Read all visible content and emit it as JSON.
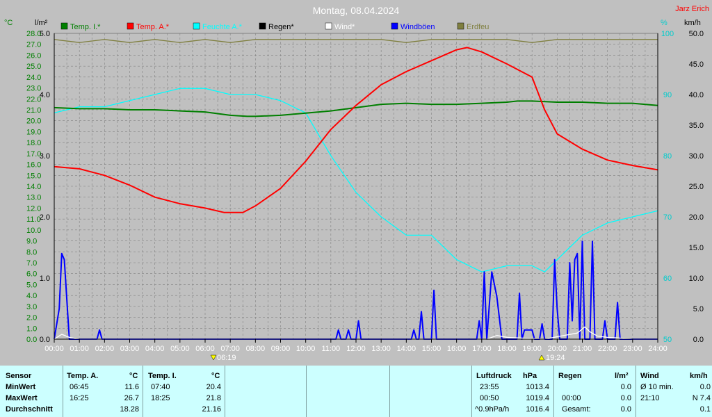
{
  "title": "Montag, 08.04.2024",
  "author": "Jarz Erich",
  "unit_labels": {
    "celsius": "°C",
    "rain": "l/m²",
    "percent": "%",
    "kmh": "km/h"
  },
  "legend": [
    {
      "label": "Temp. I.*",
      "color": "#007f00"
    },
    {
      "label": "Temp. A.*",
      "color": "#ff0000"
    },
    {
      "label": "Feuchte A.*",
      "color": "#00ffff"
    },
    {
      "label": "Regen*",
      "color": "#000000"
    },
    {
      "label": "Wind*",
      "color": "#ffffff"
    },
    {
      "label": "Windböen",
      "color": "#0000ff"
    },
    {
      "label": "Erdfeu",
      "color": "#7f7f3f"
    }
  ],
  "sun": {
    "rise": "06:19",
    "set": "19:24"
  },
  "colors": {
    "temp_axis": "#007f00",
    "humidity_axis": "#00cccc",
    "grid": "#808080",
    "panel_bg": "#ccffff"
  },
  "chart_data": {
    "type": "line",
    "title": "Montag, 08.04.2024",
    "x_ticks": [
      "00:00",
      "01:00",
      "02:00",
      "03:00",
      "04:00",
      "05:00",
      "06:00",
      "07:00",
      "08:00",
      "09:00",
      "10:00",
      "11:00",
      "12:00",
      "13:00",
      "14:00",
      "15:00",
      "16:00",
      "17:00",
      "18:00",
      "19:00",
      "20:00",
      "21:00",
      "22:00",
      "23:00",
      "24:00"
    ],
    "axes": {
      "temp_c": {
        "ylim": [
          0,
          28
        ],
        "ticks": [
          "0.0",
          "1.0",
          "2.0",
          "3.0",
          "4.0",
          "5.0",
          "6.0",
          "7.0",
          "8.0",
          "9.0",
          "10.0",
          "11.0",
          "12.0",
          "13.0",
          "14.0",
          "15.0",
          "16.0",
          "17.0",
          "18.0",
          "19.0",
          "20.0",
          "21.0",
          "22.0",
          "23.0",
          "24.0",
          "25.0",
          "26.0",
          "27.0",
          "28.0"
        ]
      },
      "rain": {
        "ylim": [
          0,
          5
        ],
        "ticks": [
          "0.0",
          "1.0",
          "2.0",
          "3.0",
          "4.0",
          "5.0"
        ]
      },
      "humidity": {
        "ylim": [
          50,
          100
        ],
        "ticks": [
          "50",
          "60",
          "70",
          "80",
          "90",
          "100"
        ]
      },
      "wind": {
        "ylim": [
          0,
          50
        ],
        "ticks": [
          "0.0",
          "5.0",
          "10.0",
          "15.0",
          "20.0",
          "25.0",
          "30.0",
          "35.0",
          "40.0",
          "45.0",
          "50.0"
        ]
      }
    },
    "series": [
      {
        "name": "Temp. I.*",
        "axis": "temp_c",
        "color": "#007f00",
        "points": [
          [
            0,
            21.2
          ],
          [
            1,
            21.1
          ],
          [
            2,
            21.1
          ],
          [
            3,
            21.0
          ],
          [
            4,
            21.0
          ],
          [
            5,
            20.9
          ],
          [
            6,
            20.8
          ],
          [
            7,
            20.5
          ],
          [
            7.67,
            20.4
          ],
          [
            8,
            20.4
          ],
          [
            9,
            20.5
          ],
          [
            10,
            20.7
          ],
          [
            11,
            20.9
          ],
          [
            12,
            21.2
          ],
          [
            13,
            21.5
          ],
          [
            14,
            21.6
          ],
          [
            15,
            21.5
          ],
          [
            16,
            21.5
          ],
          [
            17,
            21.6
          ],
          [
            18,
            21.7
          ],
          [
            18.42,
            21.8
          ],
          [
            19,
            21.8
          ],
          [
            20,
            21.7
          ],
          [
            21,
            21.7
          ],
          [
            22,
            21.6
          ],
          [
            23,
            21.6
          ],
          [
            24,
            21.4
          ]
        ]
      },
      {
        "name": "Temp. A.*",
        "axis": "temp_c",
        "color": "#ff0000",
        "points": [
          [
            0,
            15.8
          ],
          [
            1,
            15.6
          ],
          [
            2,
            15.0
          ],
          [
            3,
            14.1
          ],
          [
            4,
            13.0
          ],
          [
            5,
            12.4
          ],
          [
            6,
            12.0
          ],
          [
            6.75,
            11.6
          ],
          [
            7.5,
            11.6
          ],
          [
            8,
            12.2
          ],
          [
            9,
            13.8
          ],
          [
            10,
            16.3
          ],
          [
            11,
            19.2
          ],
          [
            12,
            21.4
          ],
          [
            13,
            23.3
          ],
          [
            14,
            24.5
          ],
          [
            15,
            25.5
          ],
          [
            16,
            26.5
          ],
          [
            16.42,
            26.7
          ],
          [
            17,
            26.3
          ],
          [
            18,
            25.2
          ],
          [
            19,
            24.0
          ],
          [
            19.5,
            21.0
          ],
          [
            20,
            18.8
          ],
          [
            21,
            17.4
          ],
          [
            22,
            16.4
          ],
          [
            23,
            15.9
          ],
          [
            24,
            15.5
          ]
        ]
      },
      {
        "name": "Feuchte A.*",
        "axis": "humidity",
        "color": "#00ffff",
        "points": [
          [
            0,
            87
          ],
          [
            1,
            88
          ],
          [
            2,
            88
          ],
          [
            3,
            89
          ],
          [
            4,
            90
          ],
          [
            5,
            91
          ],
          [
            6,
            91
          ],
          [
            7,
            90
          ],
          [
            8,
            90
          ],
          [
            9,
            89
          ],
          [
            10,
            87
          ],
          [
            11,
            80
          ],
          [
            12,
            74
          ],
          [
            13,
            70
          ],
          [
            14,
            67
          ],
          [
            15,
            67
          ],
          [
            16,
            63
          ],
          [
            17,
            61
          ],
          [
            18,
            62
          ],
          [
            19,
            62
          ],
          [
            19.5,
            61
          ],
          [
            20,
            63
          ],
          [
            21,
            67
          ],
          [
            22,
            69
          ],
          [
            23,
            70
          ],
          [
            24,
            71
          ]
        ]
      },
      {
        "name": "Windböen",
        "axis": "wind",
        "color": "#0000ff",
        "points": [
          [
            0,
            0
          ],
          [
            0.2,
            5
          ],
          [
            0.3,
            14
          ],
          [
            0.4,
            13
          ],
          [
            0.6,
            0
          ],
          [
            1.7,
            0
          ],
          [
            1.8,
            1.5
          ],
          [
            1.9,
            0
          ],
          [
            11.2,
            0
          ],
          [
            11.3,
            1.5
          ],
          [
            11.4,
            0
          ],
          [
            11.6,
            0
          ],
          [
            11.7,
            1.5
          ],
          [
            11.8,
            0
          ],
          [
            12.0,
            0
          ],
          [
            12.1,
            3
          ],
          [
            12.2,
            0
          ],
          [
            14.2,
            0
          ],
          [
            14.3,
            1.5
          ],
          [
            14.4,
            0
          ],
          [
            14.5,
            0
          ],
          [
            14.6,
            4.5
          ],
          [
            14.7,
            0
          ],
          [
            15.0,
            0
          ],
          [
            15.1,
            8
          ],
          [
            15.2,
            0
          ],
          [
            16.8,
            0
          ],
          [
            16.9,
            3
          ],
          [
            17.0,
            0
          ],
          [
            17.1,
            11
          ],
          [
            17.2,
            0
          ],
          [
            17.4,
            11
          ],
          [
            17.6,
            7
          ],
          [
            17.8,
            0
          ],
          [
            18.4,
            0
          ],
          [
            18.5,
            7.5
          ],
          [
            18.6,
            0
          ],
          [
            18.7,
            1.5
          ],
          [
            19.0,
            1.5
          ],
          [
            19.1,
            0
          ],
          [
            19.3,
            0
          ],
          [
            19.4,
            2.5
          ],
          [
            19.5,
            0
          ],
          [
            19.8,
            0
          ],
          [
            19.9,
            13
          ],
          [
            20.0,
            5
          ],
          [
            20.1,
            0
          ],
          [
            20.4,
            0
          ],
          [
            20.5,
            12.5
          ],
          [
            20.6,
            3
          ],
          [
            20.7,
            13
          ],
          [
            20.8,
            14
          ],
          [
            20.9,
            0
          ],
          [
            21.0,
            16
          ],
          [
            21.1,
            0
          ],
          [
            21.3,
            0
          ],
          [
            21.4,
            16
          ],
          [
            21.5,
            0
          ],
          [
            21.8,
            0
          ],
          [
            21.9,
            3
          ],
          [
            22.0,
            0
          ],
          [
            22.3,
            0
          ],
          [
            22.4,
            6
          ],
          [
            22.5,
            0
          ],
          [
            24,
            0
          ]
        ]
      },
      {
        "name": "Wind*",
        "axis": "wind",
        "color": "#ffffff",
        "points": [
          [
            0,
            0
          ],
          [
            0.3,
            0.8
          ],
          [
            0.6,
            0.3
          ],
          [
            1,
            0
          ],
          [
            17.2,
            0
          ],
          [
            17.6,
            0.6
          ],
          [
            18,
            0.3
          ],
          [
            19.5,
            0
          ],
          [
            20,
            0.4
          ],
          [
            20.8,
            1
          ],
          [
            21.1,
            2
          ],
          [
            21.3,
            1.2
          ],
          [
            21.6,
            0.5
          ],
          [
            22,
            0.3
          ],
          [
            22.4,
            0.2
          ],
          [
            23,
            0
          ],
          [
            24,
            0
          ]
        ]
      },
      {
        "name": "Erdfeu",
        "axis": "humidity",
        "color": "#7f7f3f",
        "points": [
          [
            0,
            99
          ],
          [
            1,
            98.5
          ],
          [
            2,
            99
          ],
          [
            3,
            98.5
          ],
          [
            4,
            99
          ],
          [
            5,
            98.5
          ],
          [
            6,
            99
          ],
          [
            7,
            98.5
          ],
          [
            8,
            99
          ],
          [
            9,
            99
          ],
          [
            10,
            99
          ],
          [
            11,
            99
          ],
          [
            12,
            99
          ],
          [
            13,
            99
          ],
          [
            14,
            98.5
          ],
          [
            15,
            99
          ],
          [
            16,
            99
          ],
          [
            17,
            99
          ],
          [
            18,
            99
          ],
          [
            19,
            98.5
          ],
          [
            20,
            99
          ],
          [
            21,
            99
          ],
          [
            22,
            99
          ],
          [
            23,
            99
          ],
          [
            24,
            99
          ]
        ]
      }
    ]
  },
  "stats": {
    "headers": {
      "sensor": "Sensor",
      "temp_a": "Temp. A.",
      "temp_i": "Temp. I.",
      "pressure": "Luftdruck",
      "rain": "Regen",
      "wind": "Wind",
      "unit_c": "°C",
      "unit_c2": "°C",
      "unit_hpa": "hPa",
      "unit_rain": "l/m²",
      "unit_kmh": "km/h"
    },
    "rows": [
      {
        "label": "MinWert",
        "ta_time": "06:45",
        "ta_val": "11.6",
        "ti_time": "07:40",
        "ti_val": "20.4",
        "p_time": "23:55",
        "p_val": "1013.4",
        "r_time": "",
        "r_val": "0.0",
        "w_time": "Ø 10 min.",
        "w_val": "0.0"
      },
      {
        "label": "MaxWert",
        "ta_time": "16:25",
        "ta_val": "26.7",
        "ti_time": "18:25",
        "ti_val": "21.8",
        "p_time": "00:50",
        "p_val": "1019.4",
        "r_time": "00:00",
        "r_val": "0.0",
        "w_time": "21:10",
        "w_val": "N 7.4"
      },
      {
        "label": "Durchschnitt",
        "ta_time": "",
        "ta_val": "18.28",
        "ti_time": "",
        "ti_val": "21.16",
        "p_time": "^0.9hPa/h",
        "p_val": "1016.4",
        "r_time": "Gesamt:",
        "r_val": "0.0",
        "w_time": "",
        "w_val": "0.1"
      }
    ]
  }
}
